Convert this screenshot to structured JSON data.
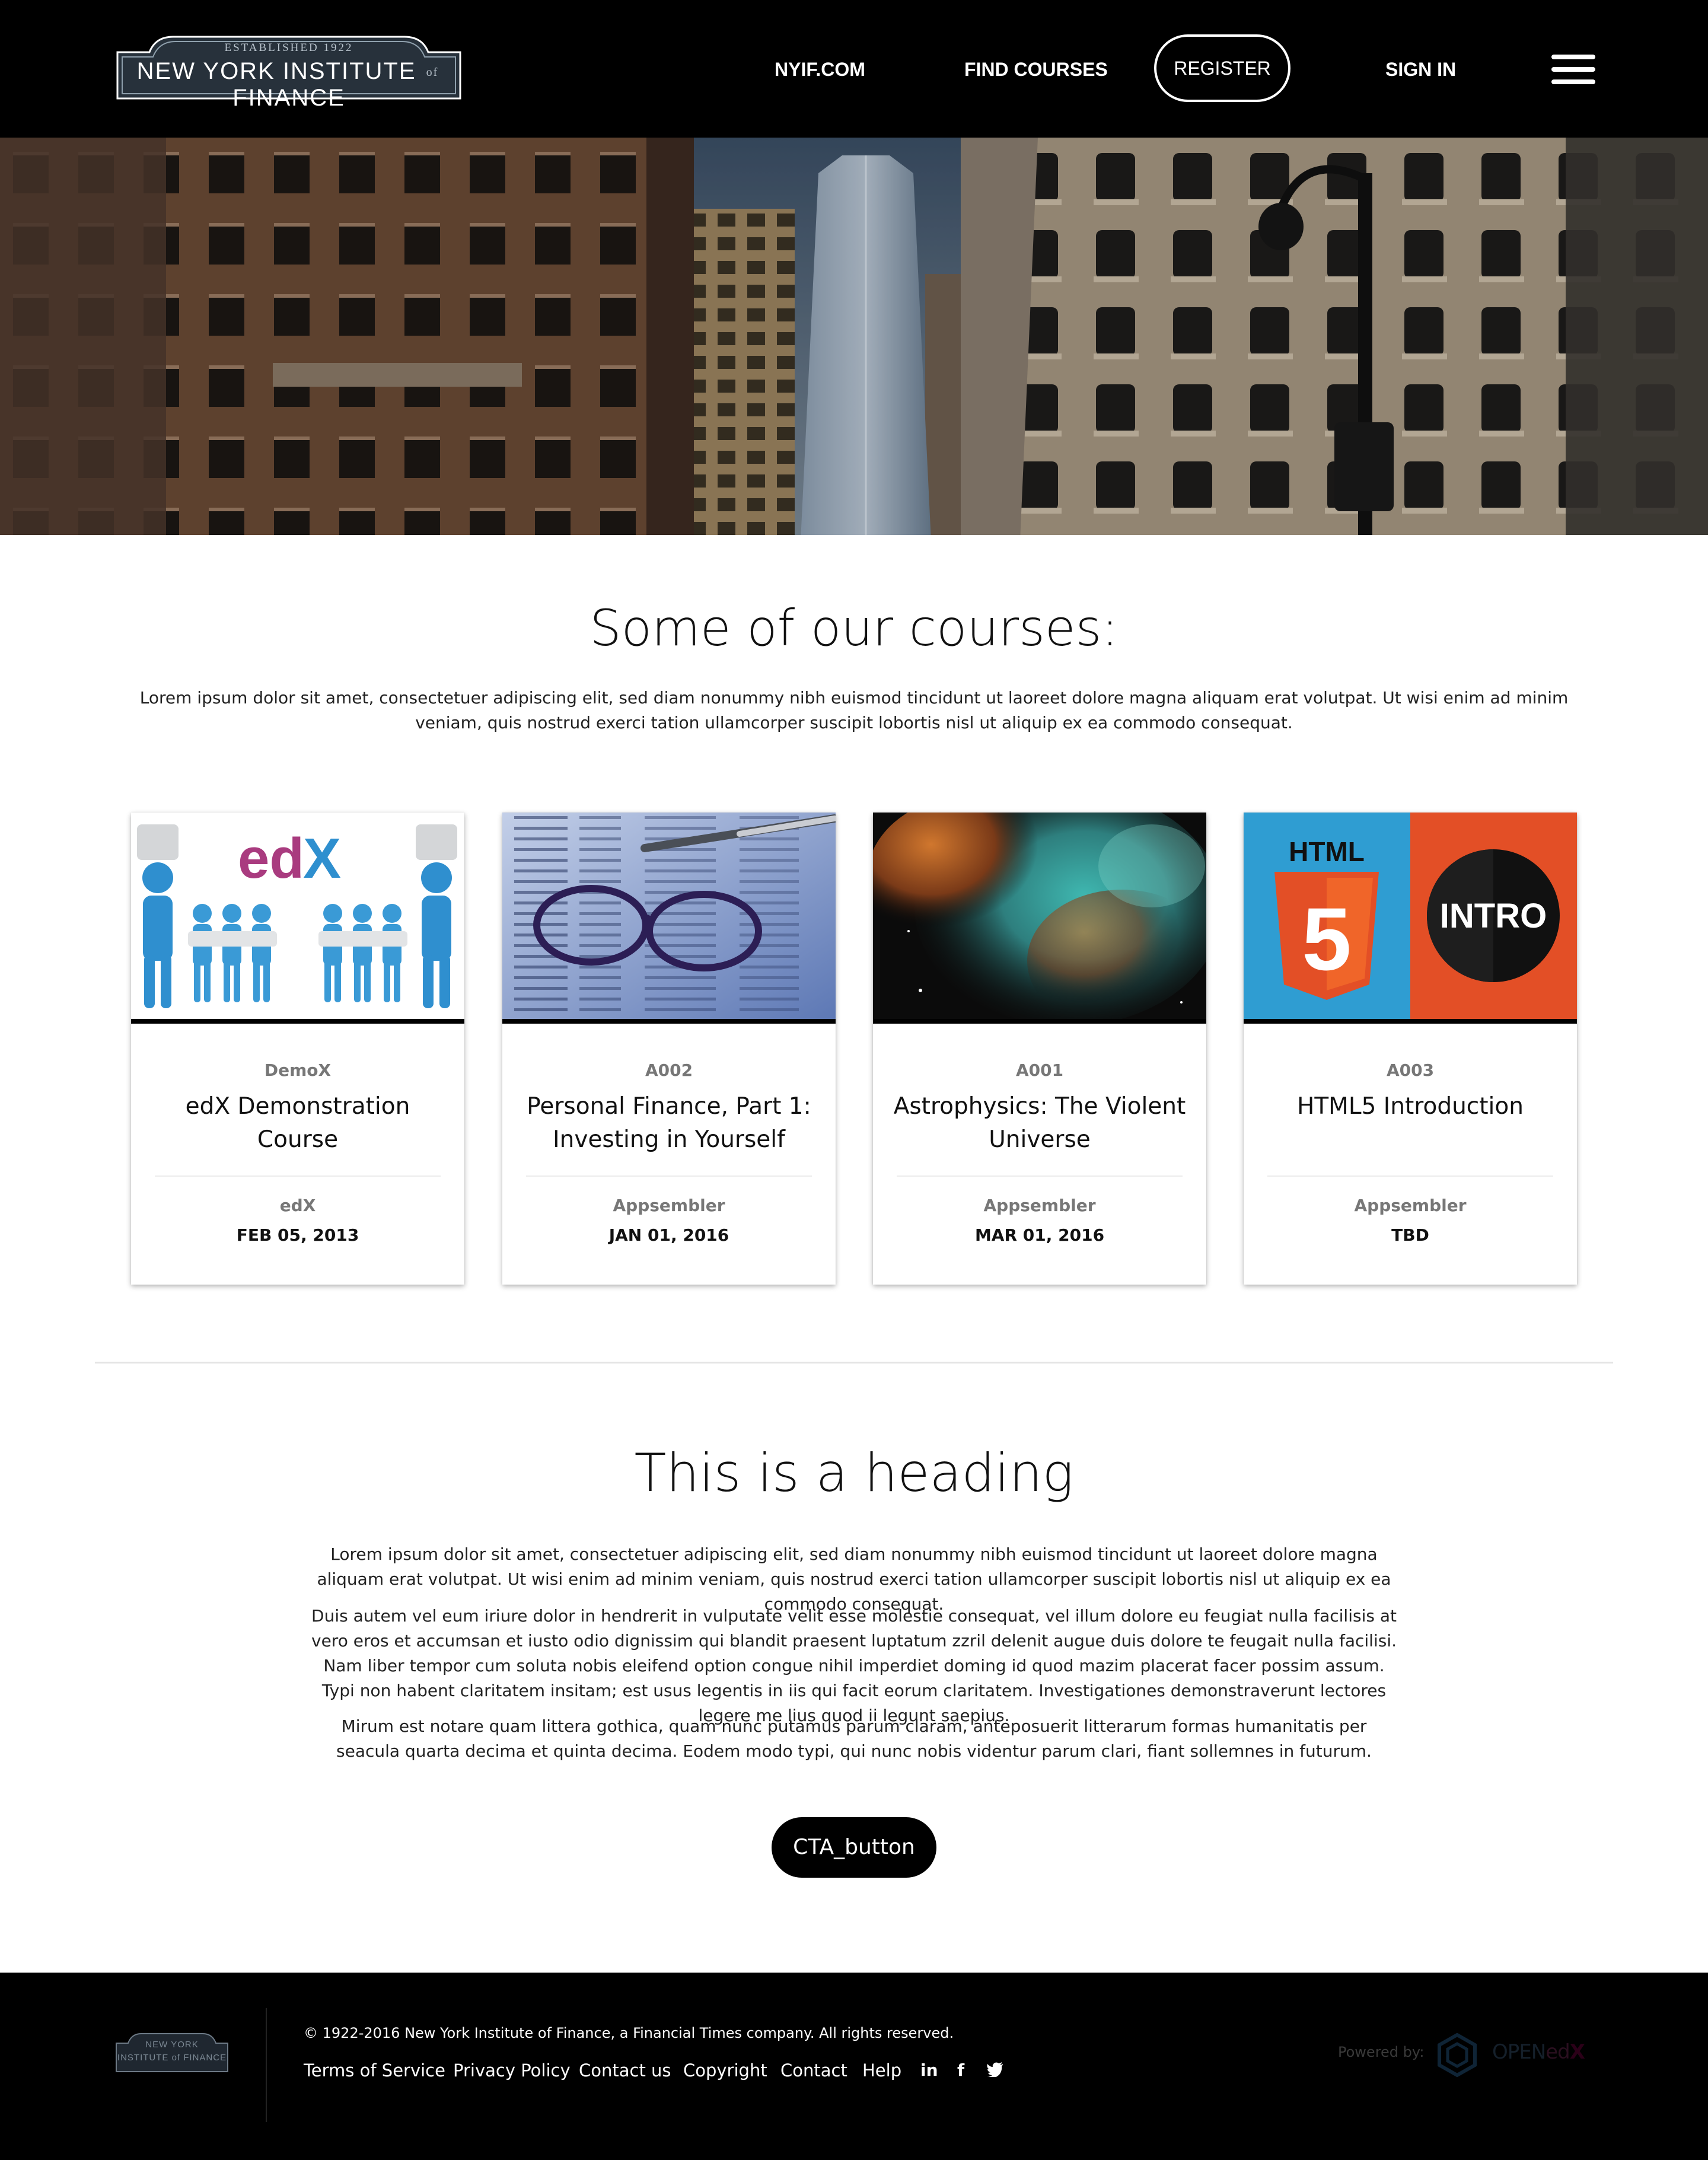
{
  "header": {
    "logo": {
      "established": "ESTABLISHED 1922",
      "name_left": "NEW YORK INSTITUTE",
      "name_of": "of",
      "name_right": "FINANCE"
    },
    "nav": {
      "nyif": "NYIF.COM",
      "find_courses": "FIND COURSES",
      "register": "REGISTER",
      "sign_in": "SIGN IN"
    },
    "menu_icon": "hamburger-icon"
  },
  "courses_section": {
    "title": "Some of our courses:",
    "intro": "Lorem ipsum dolor sit amet, consectetuer adipiscing elit, sed diam nonummy nibh euismod tincidunt ut laoreet dolore magna aliquam erat volutpat. Ut wisi enim ad minim veniam, quis nostrud exerci tation ullamcorper suscipit lobortis nisl ut aliquip ex ea commodo consequat.",
    "courses": [
      {
        "code": "DemoX",
        "title": "edX Demonstration Course",
        "org": "edX",
        "date": "FEB 05, 2013",
        "image_logo": "edX"
      },
      {
        "code": "A002",
        "title": "Personal Finance, Part 1: Investing in Yourself",
        "org": "Appsembler",
        "date": "JAN 01, 2016"
      },
      {
        "code": "A001",
        "title": "Astrophysics: The Violent Universe",
        "org": "Appsembler",
        "date": "MAR 01, 2016"
      },
      {
        "code": "A003",
        "title": "HTML5 Introduction",
        "org": "Appsembler",
        "date": "TBD",
        "image_html": "HTML",
        "image_five": "5",
        "image_intro": "INTRO"
      }
    ]
  },
  "content_section": {
    "heading": "This is a heading",
    "paragraphs": [
      "Lorem ipsum dolor sit amet, consectetuer adipiscing elit, sed diam nonummy nibh euismod tincidunt ut laoreet dolore magna aliquam erat volutpat. Ut wisi enim ad minim veniam, quis nostrud exerci tation ullamcorper suscipit lobortis nisl ut aliquip ex ea commodo consequat.",
      "Duis autem vel eum iriure dolor in hendrerit in vulputate velit esse molestie consequat, vel illum dolore eu feugiat nulla facilisis at vero eros et accumsan et iusto odio dignissim qui blandit praesent luptatum zzril delenit augue duis dolore te feugait nulla facilisi. Nam liber tempor cum soluta nobis eleifend option congue nihil imperdiet doming id quod mazim placerat facer possim assum. Typi non habent claritatem insitam; est usus legentis in iis qui facit eorum claritatem. Investigationes demonstraverunt lectores legere me lius quod ii legunt saepius.",
      "Mirum est notare quam littera gothica, quam nunc putamus parum claram, anteposuerit litterarum formas humanitatis per seacula quarta decima et quinta decima. Eodem modo typi, qui nunc nobis videntur parum clari, fiant sollemnes in futurum."
    ],
    "cta": "CTA_button"
  },
  "footer": {
    "logo_line1": "NEW YORK",
    "logo_line2": "INSTITUTE of FINANCE",
    "copyright": "© 1922-2016 New York Institute of Finance, a Financial Times company. All rights reserved.",
    "links": [
      "Terms of Service",
      "Privacy Policy",
      "Contact us",
      "Copyright",
      "Contact",
      "Help"
    ],
    "social": {
      "linkedin": "in",
      "facebook": "f",
      "twitter": "twitter-icon"
    },
    "powered_by": "Powered by:",
    "openedx_prefix": "OPEN",
    "openedx_ed": "ed",
    "openedx_x": "X"
  },
  "colors": {
    "header_bg": "#000000",
    "footer_bg": "#000000",
    "cta_bg": "#000000",
    "html5_blue": "#2f9dd2",
    "html5_orange": "#e34f26"
  }
}
